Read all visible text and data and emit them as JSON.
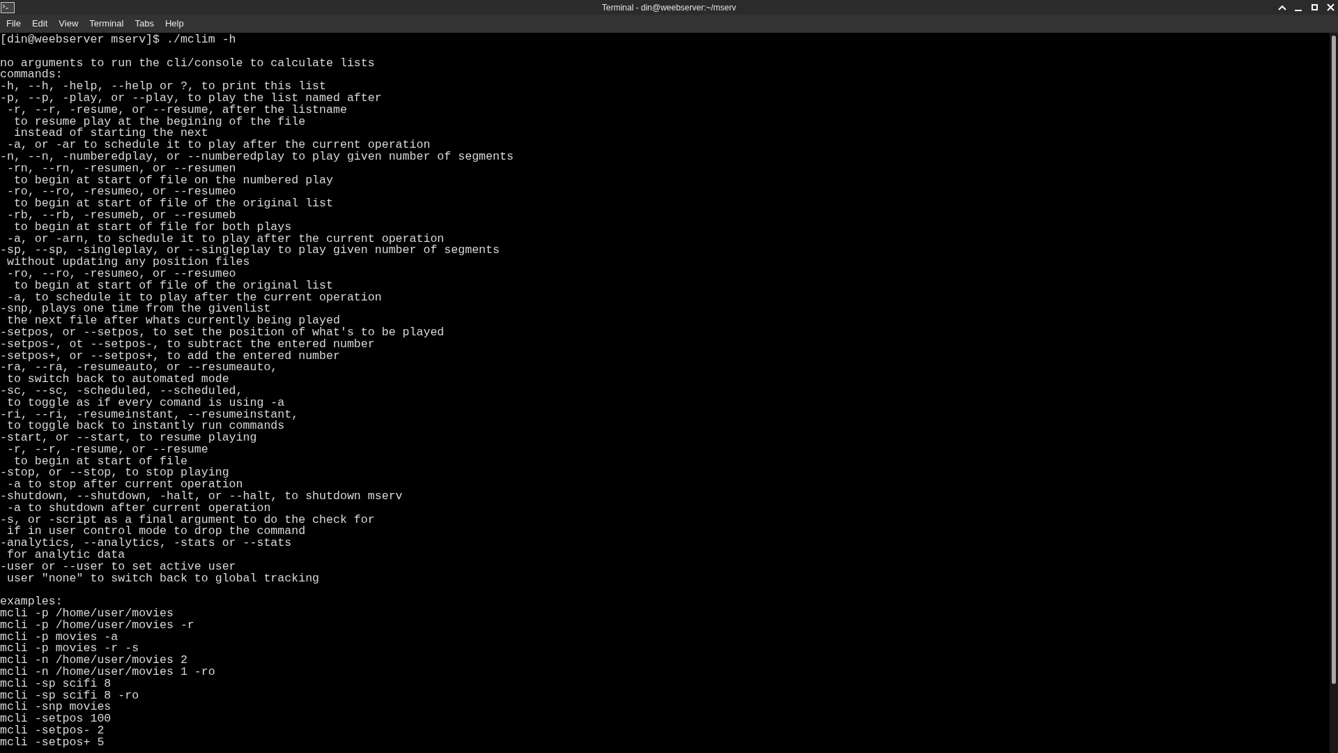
{
  "window": {
    "title": "Terminal - din@weebserver:~/mserv"
  },
  "menu": [
    "File",
    "Edit",
    "View",
    "Terminal",
    "Tabs",
    "Help"
  ],
  "terminal": {
    "prompt": "[din@weebserver mserv]$ ./mclim -h",
    "blocks": [
      [
        "no arguments to run the cli/console to calculate lists",
        "commands:",
        "-h, --h, -help, --help or ?, to print this list",
        "-p, --p, -play, or --play, to play the list named after",
        " -r, --r, -resume, or --resume, after the listname",
        "  to resume play at the begining of the file",
        "  instead of starting the next",
        " -a, or -ar to schedule it to play after the current operation",
        "-n, --n, -numberedplay, or --numberedplay to play given number of segments",
        " -rn, --rn, -resumen, or --resumen",
        "  to begin at start of file on the numbered play",
        " -ro, --ro, -resumeo, or --resumeo",
        "  to begin at start of file of the original list",
        " -rb, --rb, -resumeb, or --resumeb",
        "  to begin at start of file for both plays",
        " -a, or -arn, to schedule it to play after the current operation",
        "-sp, --sp, -singleplay, or --singleplay to play given number of segments",
        " without updating any position files",
        " -ro, --ro, -resumeo, or --resumeo",
        "  to begin at start of file of the original list",
        " -a, to schedule it to play after the current operation",
        "-snp, plays one time from the givenlist",
        " the next file after whats currently being played",
        "-setpos, or --setpos, to set the position of what's to be played",
        "-setpos-, ot --setpos-, to subtract the entered number",
        "-setpos+, or --setpos+, to add the entered number",
        "-ra, --ra, -resumeauto, or --resumeauto,",
        " to switch back to automated mode",
        "-sc, --sc, -scheduled, --scheduled,",
        " to toggle as if every comand is using -a",
        "-ri, --ri, -resumeinstant, --resumeinstant,",
        " to toggle back to instantly run commands",
        "-start, or --start, to resume playing",
        " -r, --r, -resume, or --resume",
        "  to begin at start of file",
        "-stop, or --stop, to stop playing",
        " -a to stop after current operation",
        "-shutdown, --shutdown, -halt, or --halt, to shutdown mserv",
        " -a to shutdown after current operation",
        "-s, or -script as a final argument to do the check for",
        " if in user control mode to drop the command",
        "-analytics, --analytics, -stats or --stats",
        " for analytic data",
        "-user or --user to set active user",
        " user \"none\" to switch back to global tracking"
      ],
      [
        "examples:",
        "mcli -p /home/user/movies",
        "mcli -p /home/user/movies -r",
        "mcli -p movies -a",
        "mcli -p movies -r -s",
        "mcli -n /home/user/movies 2",
        "mcli -n /home/user/movies 1 -ro",
        "mcli -sp scifi 8",
        "mcli -sp scifi 8 -ro",
        "mcli -snp movies",
        "mcli -setpos 100",
        "mcli -setpos- 2",
        "mcli -setpos+ 5"
      ]
    ]
  }
}
